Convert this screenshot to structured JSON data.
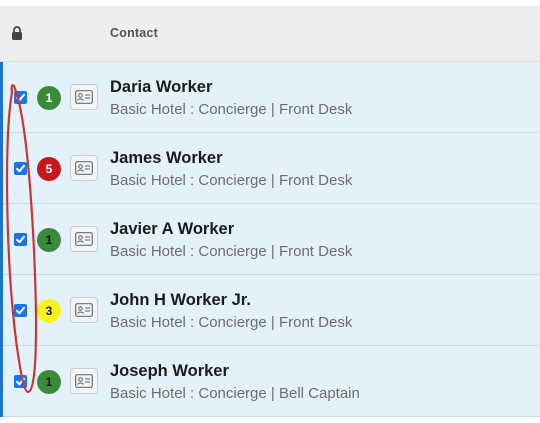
{
  "header": {
    "lock_icon": "lock-icon",
    "contact_label": "Contact"
  },
  "colors": {
    "row_bg": "#e3f1fb",
    "accent": "#1e73c8",
    "checkbox": "#1a73e8",
    "annotation": "#cc3333"
  },
  "rows": [
    {
      "name": "Daria Worker",
      "subtitle": "Basic Hotel : Concierge | Front Desk",
      "count": "1",
      "badge_color": "#3a8a3a",
      "badge_text_color": "#ffffff",
      "checked": true
    },
    {
      "name": "James Worker",
      "subtitle": "Basic Hotel : Concierge | Front Desk",
      "count": "5",
      "badge_color": "#c8161d",
      "badge_text_color": "#ffffff",
      "checked": true
    },
    {
      "name": "Javier A Worker",
      "subtitle": "Basic Hotel : Concierge | Front Desk",
      "count": "1",
      "badge_color": "#3a8a3a",
      "badge_text_color": "#1b1b1b",
      "checked": true
    },
    {
      "name": "John H Worker Jr.",
      "subtitle": "Basic Hotel : Concierge | Front Desk",
      "count": "3",
      "badge_color": "#f7f21e",
      "badge_text_color": "#1b1b1b",
      "checked": true
    },
    {
      "name": "Joseph Worker",
      "subtitle": "Basic Hotel : Concierge | Bell Captain",
      "count": "1",
      "badge_color": "#3a8a3a",
      "badge_text_color": "#1b1b1b",
      "checked": true
    }
  ]
}
